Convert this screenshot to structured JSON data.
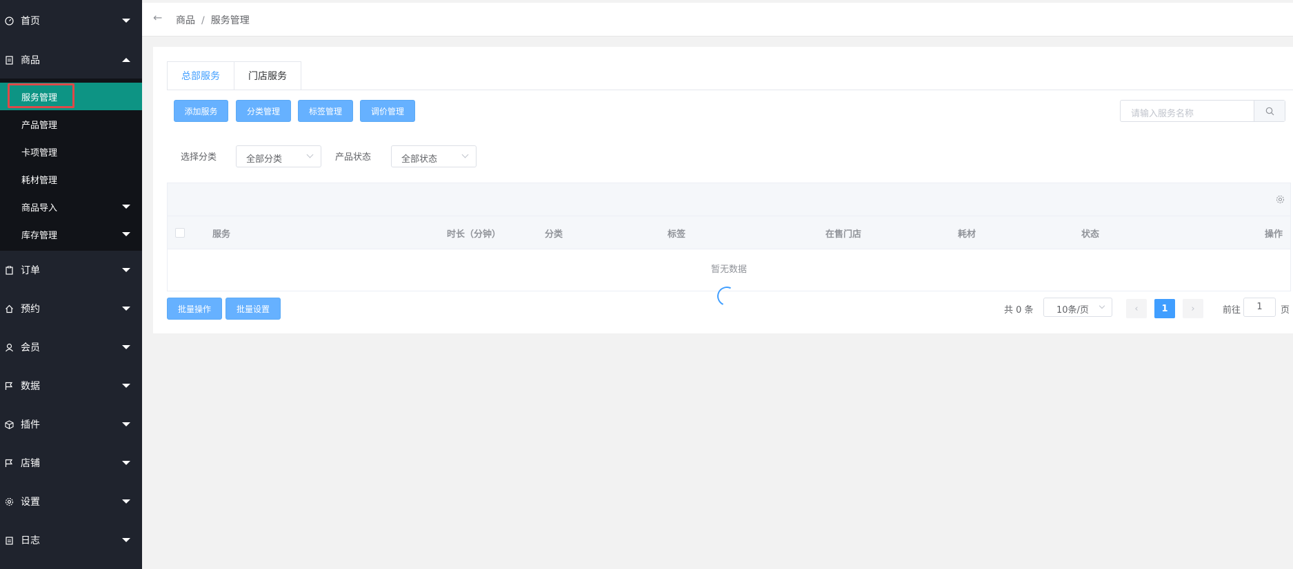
{
  "sidebar": {
    "menu": [
      {
        "label": "首页",
        "icon": "dashboard-icon",
        "expanded": false
      },
      {
        "label": "商品",
        "icon": "document-icon",
        "expanded": true
      },
      {
        "label": "订单",
        "icon": "clipboard-icon",
        "expanded": false
      },
      {
        "label": "预约",
        "icon": "home-icon",
        "expanded": false
      },
      {
        "label": "会员",
        "icon": "user-icon",
        "expanded": false
      },
      {
        "label": "数据",
        "icon": "flag-icon",
        "expanded": false
      },
      {
        "label": "插件",
        "icon": "cube-icon",
        "expanded": false
      },
      {
        "label": "店铺",
        "icon": "flag-icon",
        "expanded": false
      },
      {
        "label": "设置",
        "icon": "gear-icon",
        "expanded": false
      },
      {
        "label": "日志",
        "icon": "clipboard-icon",
        "expanded": false
      }
    ],
    "submenu": [
      {
        "label": "服务管理",
        "active": true
      },
      {
        "label": "产品管理"
      },
      {
        "label": "卡项管理"
      },
      {
        "label": "耗材管理"
      },
      {
        "label": "商品导入",
        "has_children": true
      },
      {
        "label": "库存管理",
        "has_children": true
      }
    ],
    "colors": {
      "bg": "#1f232d",
      "submenu_bg": "#111318",
      "active": "#0d9484",
      "highlight_border": "#e04848"
    }
  },
  "header": {
    "breadcrumb": [
      "商品",
      "服务管理"
    ],
    "separator": "/"
  },
  "tabs": [
    {
      "label": "总部服务",
      "active": true
    },
    {
      "label": "门店服务",
      "active": false
    }
  ],
  "toolbar": {
    "add": "添加服务",
    "category": "分类管理",
    "tag": "标签管理",
    "price": "调价管理"
  },
  "search": {
    "placeholder": "请输入服务名称",
    "icon": "search-icon"
  },
  "filters": {
    "category_label": "选择分类",
    "category_value": "全部分类",
    "status_label": "产品状态",
    "status_value": "全部状态"
  },
  "table": {
    "columns": [
      "服务",
      "时长（分钟）",
      "分类",
      "标签",
      "在售门店",
      "耗材",
      "状态",
      "操作"
    ],
    "empty_text": "暂无数据",
    "rows": []
  },
  "bulk": {
    "batch_ops": "批量操作",
    "batch_set": "批量设置"
  },
  "pagination": {
    "total": "共 0 条",
    "page_size": "10条/页",
    "current": "1",
    "goto_prefix": "前往",
    "goto_value": "1",
    "goto_suffix": "页"
  },
  "accent_color": "#409eff"
}
